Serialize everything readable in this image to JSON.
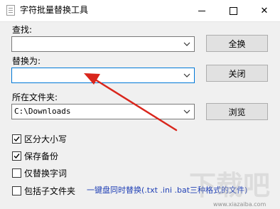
{
  "window": {
    "title": "字符批量替换工具",
    "close_glyph": "✕"
  },
  "find": {
    "label": "查找:",
    "value": ""
  },
  "replace": {
    "label": "替换为:",
    "value": ""
  },
  "folder": {
    "label": "所在文件夹:",
    "value": "C:\\Downloads"
  },
  "buttons": {
    "replace_all": "全换",
    "close": "关闭",
    "browse": "浏览"
  },
  "options": [
    {
      "label": "区分大小写",
      "checked": true
    },
    {
      "label": "保存备份",
      "checked": true
    },
    {
      "label": "仅替换字词",
      "checked": false
    },
    {
      "label": "包括子文件夹",
      "checked": false
    }
  ],
  "hint": "一键盘同时替换(.txt .ini .bat三种格式的文件)",
  "watermark": {
    "text": "下载吧",
    "url": "www.xiazaiba.com"
  },
  "colors": {
    "window_bg": "#f0f0f0",
    "focus_border": "#0078d7",
    "hint_text": "#1f3fb5",
    "annotation_arrow": "#d9261c"
  }
}
